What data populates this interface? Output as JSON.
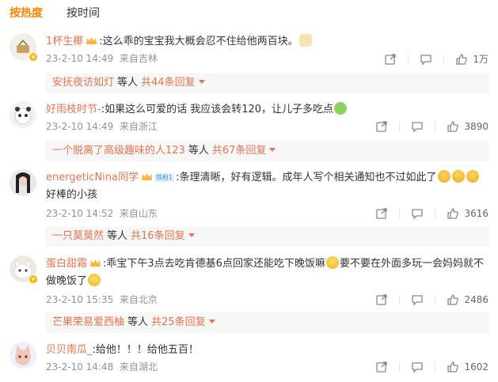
{
  "sort_tabs": [
    {
      "label": "按热度",
      "active": true
    },
    {
      "label": "按时间",
      "active": false
    }
  ],
  "comments": [
    {
      "username": "1杯生椰",
      "text": ":这么乖的宝宝我大概会忍不住给他两百块。",
      "time": "23-2-10 14:49",
      "location": "来自吉林",
      "likes": "1万",
      "reply_user": "安抚夜访如灯",
      "reply_mid": "等人",
      "reply_count": "共44条回复"
    },
    {
      "username": "好雨枝时节-",
      "text": ":如果这么可爱的话 我应该会转120，让儿子多吃点",
      "time": "23-2-10 14:49",
      "location": "来自浙江",
      "likes": "3890",
      "reply_user": "一个脱离了高级趣味的人123",
      "reply_mid": "等人",
      "reply_count": "共67条回复"
    },
    {
      "username": "energeticNina同学",
      "badge": "铁粉1",
      "text_a": ":条理清晰，好有逻辑。成年人写个相关通知也不过如此了",
      "text_b": "好棒的小孩",
      "time": "23-2-10 14:52",
      "location": "来自山东",
      "likes": "3616",
      "reply_user": "一只莫莫然",
      "reply_mid": "等人",
      "reply_count": "共16条回复"
    },
    {
      "username": "蛋白甜霜",
      "text_a": ":乖宝下午3点去吃肯德基6点回家还能吃下晚饭嘛",
      "text_b": "要不要在外面多玩一会妈妈就不做晚饭了",
      "time": "23-2-10 15:35",
      "location": "来自北京",
      "likes": "2486",
      "reply_user": "芒果荣易爱西柚",
      "reply_mid": "等人",
      "reply_count": "共25条回复"
    },
    {
      "username": "贝贝南瓜_",
      "text": ":给他！！！给他五百！",
      "time": "23-2-10 14:48",
      "location": "来自湖北",
      "likes": "1602"
    }
  ],
  "colors": {
    "accent": "#ff8200",
    "username": "#eb7350",
    "meta": "#939393",
    "reply_bg": "#f7f7f7"
  }
}
